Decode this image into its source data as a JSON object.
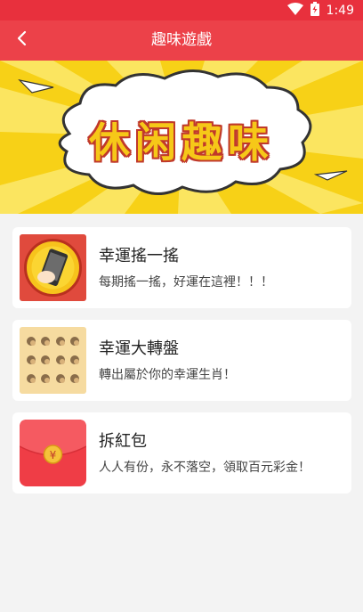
{
  "status": {
    "time": "1:49"
  },
  "header": {
    "title": "趣味遊戲"
  },
  "banner": {
    "title": "休闲趣味"
  },
  "games": [
    {
      "title": "幸運搖一搖",
      "desc": "每期搖一搖，好運在這裡！！！",
      "icon": "phone-shake-icon"
    },
    {
      "title": "幸運大轉盤",
      "desc": "轉出屬於你的幸運生肖！",
      "icon": "zodiac-grid-icon"
    },
    {
      "title": "拆紅包",
      "desc": "人人有份，永不落空，領取百元彩金！",
      "icon": "red-envelope-icon"
    }
  ],
  "envelope_symbol": "¥",
  "colors": {
    "header": "#ec4149",
    "statusbar": "#e8303d",
    "background": "#f3f3f3",
    "banner_yellow": "#f7d117"
  }
}
